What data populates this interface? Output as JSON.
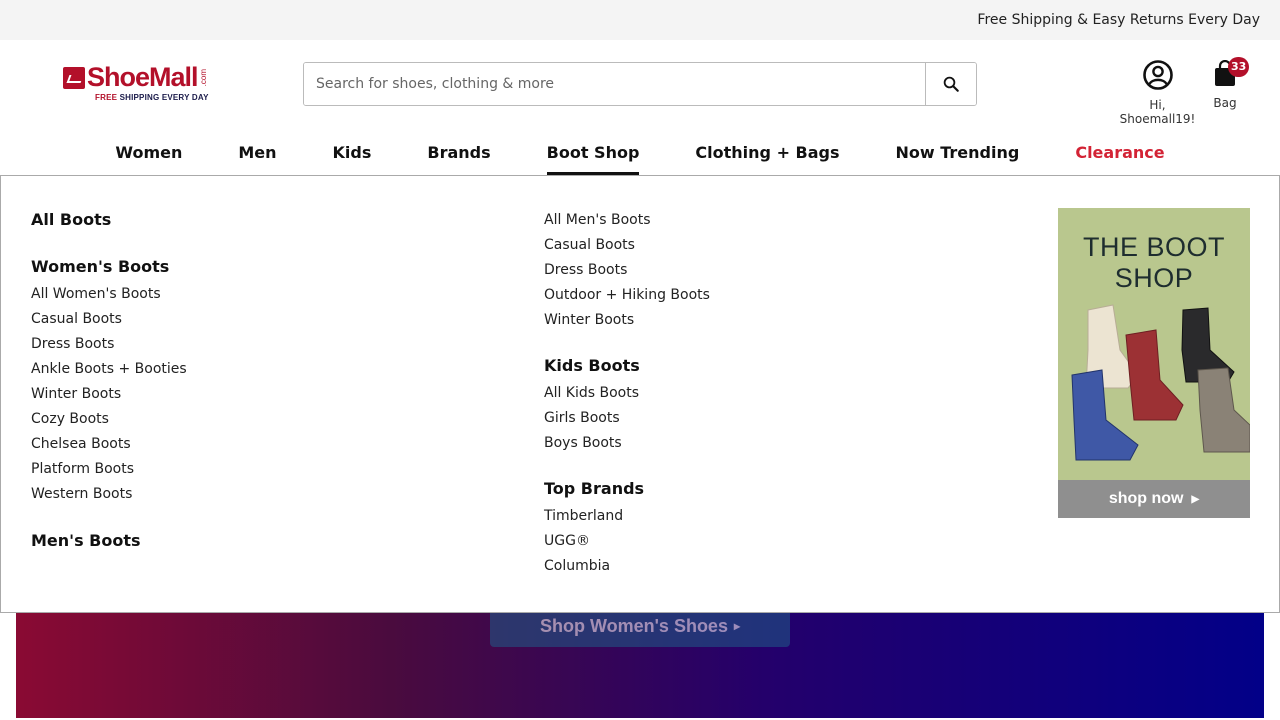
{
  "promo_bar": {
    "text": "Free Shipping & Easy Returns Every Day"
  },
  "logo": {
    "name": "ShoeMall",
    "com": ".com",
    "tag_free": "FREE",
    "tag_rest": " SHIPPING EVERY DAY"
  },
  "search": {
    "placeholder": "Search for shoes, clothing & more",
    "value": ""
  },
  "account": {
    "label": "Hi, Shoemall19!",
    "icon": "account-circle-icon"
  },
  "bag": {
    "label": "Bag",
    "count": "33",
    "icon": "shopping-bag-icon"
  },
  "nav": {
    "items": [
      {
        "label": "Women"
      },
      {
        "label": "Men"
      },
      {
        "label": "Kids"
      },
      {
        "label": "Brands"
      },
      {
        "label": "Boot Shop"
      },
      {
        "label": "Clothing + Bags"
      },
      {
        "label": "Now Trending"
      },
      {
        "label": "Clearance"
      }
    ],
    "active": "Boot Shop",
    "clearance_color": "#d32335"
  },
  "mega_menu": {
    "col1": {
      "all_boots": "All Boots",
      "womens_heading": "Women's Boots",
      "womens": [
        "All Women's Boots",
        "Casual Boots",
        "Dress Boots",
        "Ankle Boots + Booties",
        "Winter Boots",
        "Cozy Boots",
        "Chelsea Boots",
        "Platform Boots",
        "Western Boots"
      ],
      "mens_heading": "Men's Boots"
    },
    "col2": {
      "mens": [
        "All Men's Boots",
        "Casual Boots",
        "Dress Boots",
        "Outdoor + Hiking Boots",
        "Winter Boots"
      ],
      "kids_heading": "Kids Boots",
      "kids": [
        "All Kids Boots",
        "Girls Boots",
        "Boys Boots"
      ],
      "brands_heading": "Top Brands",
      "brands": [
        "Timberland",
        "UGG®",
        "Columbia"
      ]
    },
    "promo": {
      "title_line1": "THE BOOT",
      "title_line2": "SHOP",
      "cta": "shop now"
    }
  },
  "hero": {
    "button": "Shop Women's Shoes"
  },
  "colors": {
    "brand": "#b3102a",
    "clearance": "#d32335",
    "promo_bg": "#b9c78e"
  }
}
